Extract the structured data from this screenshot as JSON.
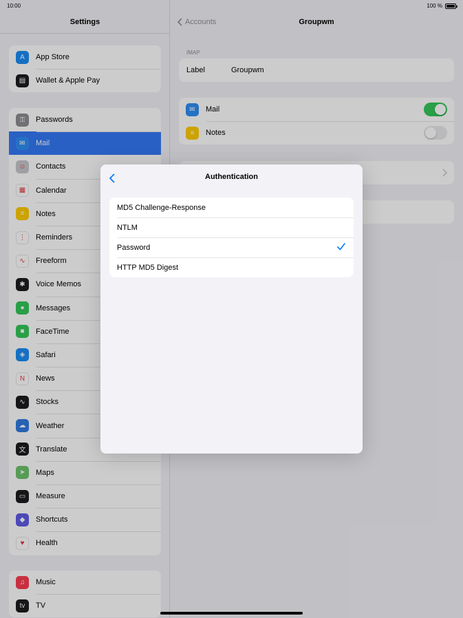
{
  "status": {
    "time": "10:00",
    "battery": "100 %"
  },
  "sidebar": {
    "title": "Settings",
    "group1": [
      {
        "label": "App Store",
        "icon": "app-store-icon",
        "color": "#1a8cf5",
        "glyph": "A"
      },
      {
        "label": "Wallet & Apple Pay",
        "icon": "wallet-icon",
        "color": "#1c1c1e",
        "glyph": "▤"
      }
    ],
    "group2": [
      {
        "label": "Passwords",
        "icon": "key-icon",
        "color": "#8e8e93",
        "glyph": "⚿"
      },
      {
        "label": "Mail",
        "icon": "mail-icon",
        "color": "#2f8ef5",
        "glyph": "✉",
        "selected": true
      },
      {
        "label": "Contacts",
        "icon": "contacts-icon",
        "color": "#c7c7cc",
        "glyph": "☺"
      },
      {
        "label": "Calendar",
        "icon": "calendar-icon",
        "color": "#ffffff",
        "glyph": "▦"
      },
      {
        "label": "Notes",
        "icon": "notes-icon",
        "color": "#ffcc00",
        "glyph": "≡"
      },
      {
        "label": "Reminders",
        "icon": "reminders-icon",
        "color": "#ffffff",
        "glyph": "⋮"
      },
      {
        "label": "Freeform",
        "icon": "freeform-icon",
        "color": "#ffffff",
        "glyph": "∿"
      },
      {
        "label": "Voice Memos",
        "icon": "voice-memos-icon",
        "color": "#1c1c1e",
        "glyph": "✱"
      },
      {
        "label": "Messages",
        "icon": "messages-icon",
        "color": "#34c759",
        "glyph": "●"
      },
      {
        "label": "FaceTime",
        "icon": "facetime-icon",
        "color": "#34c759",
        "glyph": "■"
      },
      {
        "label": "Safari",
        "icon": "safari-icon",
        "color": "#1a8cf5",
        "glyph": "◈"
      },
      {
        "label": "News",
        "icon": "news-icon",
        "color": "#ffffff",
        "glyph": "N"
      },
      {
        "label": "Stocks",
        "icon": "stocks-icon",
        "color": "#1c1c1e",
        "glyph": "∿"
      },
      {
        "label": "Weather",
        "icon": "weather-icon",
        "color": "#2f7be0",
        "glyph": "☁"
      },
      {
        "label": "Translate",
        "icon": "translate-icon",
        "color": "#1c1c1e",
        "glyph": "文"
      },
      {
        "label": "Maps",
        "icon": "maps-icon",
        "color": "#6cc36b",
        "glyph": "➤"
      },
      {
        "label": "Measure",
        "icon": "measure-icon",
        "color": "#1c1c1e",
        "glyph": "▭"
      },
      {
        "label": "Shortcuts",
        "icon": "shortcuts-icon",
        "color": "#5e5ce6",
        "glyph": "◆"
      },
      {
        "label": "Health",
        "icon": "health-icon",
        "color": "#ffffff",
        "glyph": "♥"
      }
    ],
    "group3": [
      {
        "label": "Music",
        "icon": "music-icon",
        "color": "#fa3c4f",
        "glyph": "♫"
      },
      {
        "label": "TV",
        "icon": "tv-icon",
        "color": "#1c1c1e",
        "glyph": "tv"
      }
    ]
  },
  "main": {
    "back_label": "Accounts",
    "title": "Groupwm",
    "section_label": "IMAP",
    "label_key": "Label",
    "label_value": "Groupwm",
    "mail_label": "Mail",
    "notes_label": "Notes",
    "mail_on": true,
    "notes_on": false
  },
  "modal": {
    "title": "Authentication",
    "options": [
      {
        "label": "MD5 Challenge-Response",
        "checked": false
      },
      {
        "label": "NTLM",
        "checked": false
      },
      {
        "label": "Password",
        "checked": true
      },
      {
        "label": "HTTP MD5 Digest",
        "checked": false
      }
    ],
    "accent": "#007aff"
  }
}
